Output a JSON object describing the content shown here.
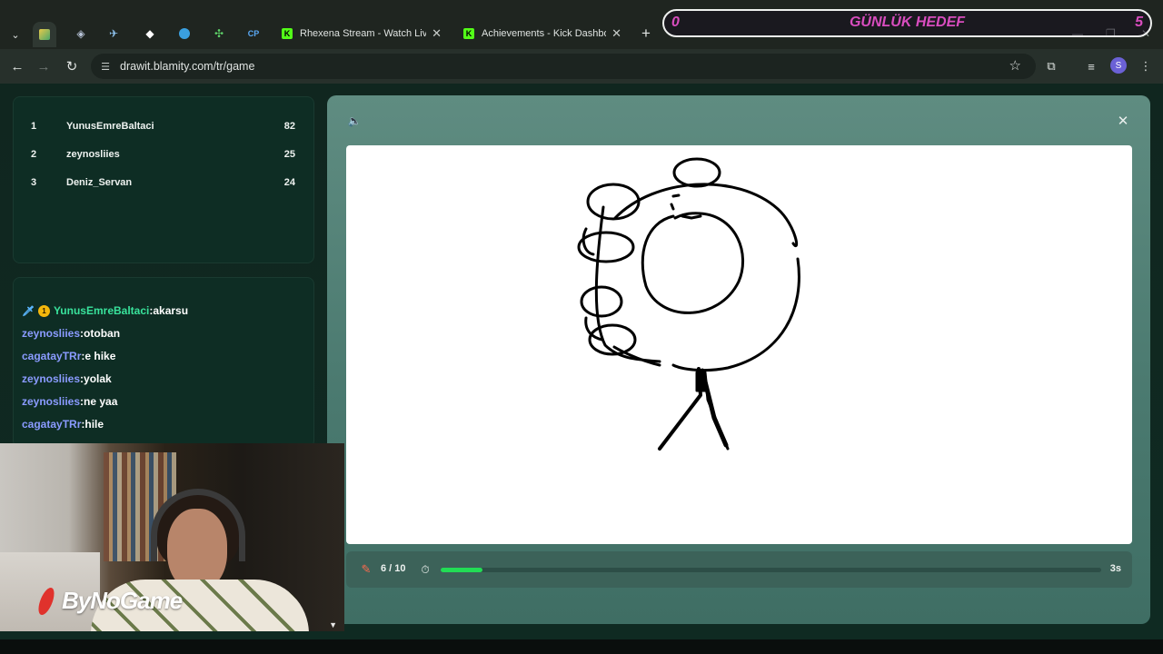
{
  "browser": {
    "tabs": [
      {
        "title": "Rhexena Stream - Watch Live o",
        "favicon": "kick-icon"
      },
      {
        "title": "Achievements - Kick Dashboard",
        "favicon": "kick-icon"
      }
    ],
    "pinned_icons": [
      "drawit-icon",
      "kitty-icon",
      "steam-icon",
      "diamond-icon",
      "app-icon",
      "puzzle-icon"
    ],
    "pinned_cp_label": "CP",
    "url": "drawit.blamity.com/tr/game",
    "profile_initial": "S"
  },
  "goal_overlay": {
    "current": "0",
    "title": "GÜNLÜK HEDEF",
    "target": "5"
  },
  "scoreboard": [
    {
      "rank": "1",
      "player": "YunusEmreBaltaci",
      "points": "82"
    },
    {
      "rank": "2",
      "player": "zeynosliies",
      "points": "25"
    },
    {
      "rank": "3",
      "player": "Deniz_Servan",
      "points": "24"
    }
  ],
  "chat": [
    {
      "user": "YunusEmreBaltaci",
      "message": "akarsu",
      "badges": [
        "sword-icon",
        "coin-badge"
      ],
      "badge_text": "1"
    },
    {
      "user": "zeynosliies",
      "message": "otoban"
    },
    {
      "user": "cagatayTRr",
      "message": "e hike"
    },
    {
      "user": "zeynosliies",
      "message": "yolak"
    },
    {
      "user": "zeynosliies",
      "message": "ne yaa"
    },
    {
      "user": "cagatayTRr",
      "message": "hile"
    }
  ],
  "game": {
    "round_text": "6 / 10",
    "time_left": "3s",
    "progress": 0.063
  },
  "webcam": {
    "watermark": "ByNoGame"
  },
  "colors": {
    "accent_green": "#22dd55",
    "goal_pink": "#d94dbf",
    "chat_top_user": "#39e39c",
    "chat_user": "#8a9bff",
    "kick_green": "#53fc18"
  }
}
